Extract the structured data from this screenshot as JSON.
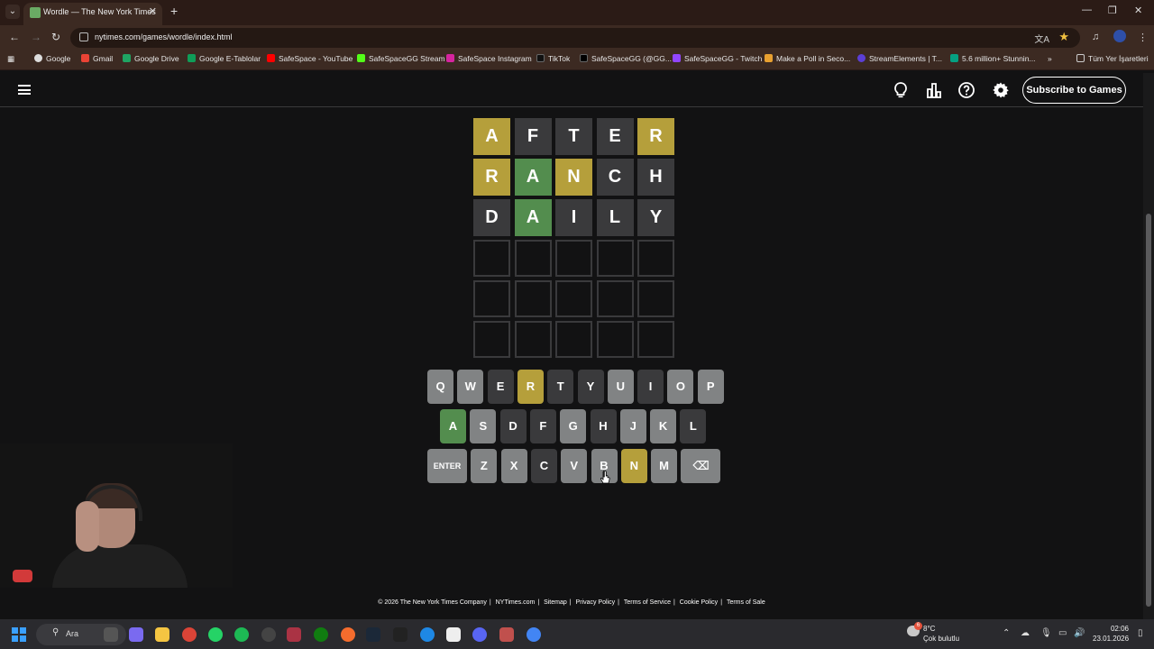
{
  "browser": {
    "tab_title": "Wordle — The New York Times",
    "url": "nytimes.com/games/wordle/index.html",
    "bookmarks": [
      "Google",
      "Gmail",
      "Google Drive",
      "Google E-Tablolar",
      "SafeSpace - YouTube",
      "SafeSpaceGG Stream",
      "SafeSpace Instagram",
      "TikTok",
      "SafeSpaceGG (@GG...",
      "SafeSpaceGG - Twitch",
      "Make a Poll in Seco...",
      "StreamElements | T...",
      "5.6 million+ Stunnin..."
    ],
    "bookmarks_more": "»",
    "all_bookmarks": "Tüm Yer İşaretleri"
  },
  "header": {
    "subscribe_label": "Subscribe to Games",
    "icons": [
      "menu-icon",
      "hint-icon",
      "stats-icon",
      "help-icon",
      "settings-icon"
    ]
  },
  "board": {
    "rows": [
      [
        {
          "l": "A",
          "s": "present"
        },
        {
          "l": "F",
          "s": "absent"
        },
        {
          "l": "T",
          "s": "absent"
        },
        {
          "l": "E",
          "s": "absent"
        },
        {
          "l": "R",
          "s": "present"
        }
      ],
      [
        {
          "l": "R",
          "s": "present"
        },
        {
          "l": "A",
          "s": "correct"
        },
        {
          "l": "N",
          "s": "present"
        },
        {
          "l": "C",
          "s": "absent"
        },
        {
          "l": "H",
          "s": "absent"
        }
      ],
      [
        {
          "l": "D",
          "s": "absent"
        },
        {
          "l": "A",
          "s": "correct"
        },
        {
          "l": "I",
          "s": "absent"
        },
        {
          "l": "L",
          "s": "absent"
        },
        {
          "l": "Y",
          "s": "absent"
        }
      ],
      [
        {
          "l": "",
          "s": "empty"
        },
        {
          "l": "",
          "s": "empty"
        },
        {
          "l": "",
          "s": "empty"
        },
        {
          "l": "",
          "s": "empty"
        },
        {
          "l": "",
          "s": "empty"
        }
      ],
      [
        {
          "l": "",
          "s": "empty"
        },
        {
          "l": "",
          "s": "empty"
        },
        {
          "l": "",
          "s": "empty"
        },
        {
          "l": "",
          "s": "empty"
        },
        {
          "l": "",
          "s": "empty"
        }
      ],
      [
        {
          "l": "",
          "s": "empty"
        },
        {
          "l": "",
          "s": "empty"
        },
        {
          "l": "",
          "s": "empty"
        },
        {
          "l": "",
          "s": "empty"
        },
        {
          "l": "",
          "s": "empty"
        }
      ]
    ]
  },
  "keyboard": {
    "rows": [
      [
        {
          "k": "Q",
          "s": "unused"
        },
        {
          "k": "W",
          "s": "unused"
        },
        {
          "k": "E",
          "s": "absent"
        },
        {
          "k": "R",
          "s": "present"
        },
        {
          "k": "T",
          "s": "absent"
        },
        {
          "k": "Y",
          "s": "absent"
        },
        {
          "k": "U",
          "s": "unused"
        },
        {
          "k": "I",
          "s": "absent"
        },
        {
          "k": "O",
          "s": "unused"
        },
        {
          "k": "P",
          "s": "unused"
        }
      ],
      [
        {
          "k": "A",
          "s": "correct"
        },
        {
          "k": "S",
          "s": "unused"
        },
        {
          "k": "D",
          "s": "absent"
        },
        {
          "k": "F",
          "s": "absent"
        },
        {
          "k": "G",
          "s": "unused"
        },
        {
          "k": "H",
          "s": "absent"
        },
        {
          "k": "J",
          "s": "unused"
        },
        {
          "k": "K",
          "s": "unused"
        },
        {
          "k": "L",
          "s": "absent"
        }
      ],
      [
        {
          "k": "ENTER",
          "s": "unused"
        },
        {
          "k": "Z",
          "s": "unused"
        },
        {
          "k": "X",
          "s": "unused"
        },
        {
          "k": "C",
          "s": "absent"
        },
        {
          "k": "V",
          "s": "unused"
        },
        {
          "k": "B",
          "s": "unused"
        },
        {
          "k": "N",
          "s": "present"
        },
        {
          "k": "M",
          "s": "unused"
        },
        {
          "k": "⌫",
          "s": "unused"
        }
      ]
    ]
  },
  "footer": {
    "links": [
      "© 2026 The New York Times Company",
      "NYTimes.com",
      "Sitemap",
      "Privacy Policy",
      "Terms of Service",
      "Cookie Policy",
      "Terms of Sale"
    ]
  },
  "taskbar": {
    "search_label": "Ara",
    "weather_temp": "8°C",
    "weather_desc": "Çok bulutlu",
    "weather_badge": "6",
    "time": "02:06",
    "date": "23.01.2026"
  },
  "colors": {
    "correct": "#538d4e",
    "present": "#b59f3b",
    "absent": "#3a3a3c",
    "unused": "#818384",
    "background": "#121213"
  }
}
